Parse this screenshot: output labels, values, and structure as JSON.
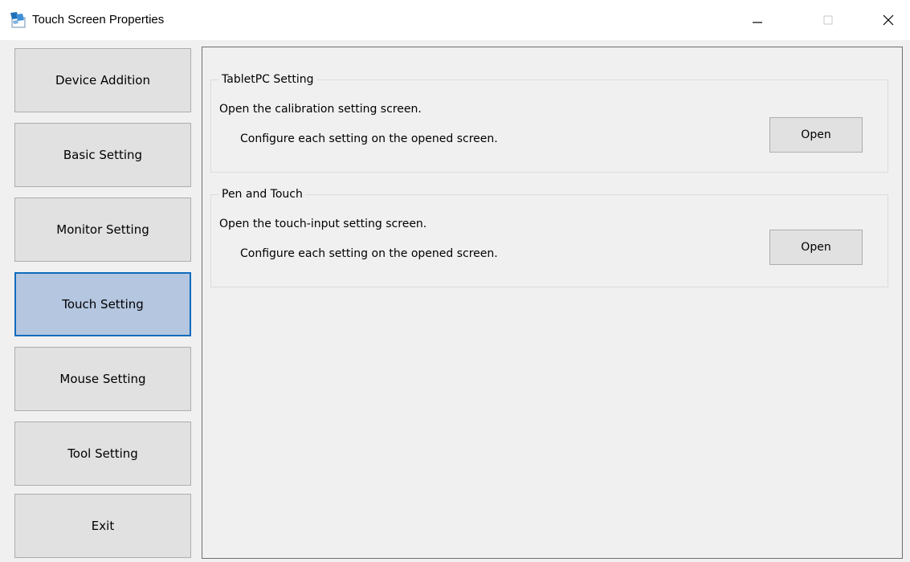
{
  "window": {
    "title": "Touch Screen Properties",
    "icons": {
      "app": "app-icon",
      "minimize": "minimize-icon",
      "maximize": "maximize-icon",
      "close": "close-icon"
    }
  },
  "nav": {
    "items": [
      {
        "label": "Device Addition",
        "active": false
      },
      {
        "label": "Basic Setting",
        "active": false
      },
      {
        "label": "Monitor Setting",
        "active": false
      },
      {
        "label": "Touch Setting",
        "active": true
      },
      {
        "label": "Mouse Setting",
        "active": false
      },
      {
        "label": "Tool Setting",
        "active": false
      },
      {
        "label": "Exit",
        "active": false
      }
    ]
  },
  "groups": [
    {
      "label": "TabletPC Setting",
      "line1": "Open the calibration setting screen.",
      "line2": "Configure each setting on the opened screen.",
      "button": "Open"
    },
    {
      "label": "Pen and Touch",
      "line1": "Open the touch-input setting screen.",
      "line2": "Configure each setting on the opened screen.",
      "button": "Open"
    }
  ],
  "colors": {
    "window_bg": "#f0f0f0",
    "button_bg": "#e1e1e1",
    "active_bg": "#b4c6e0",
    "active_border": "#0f6cbd"
  }
}
